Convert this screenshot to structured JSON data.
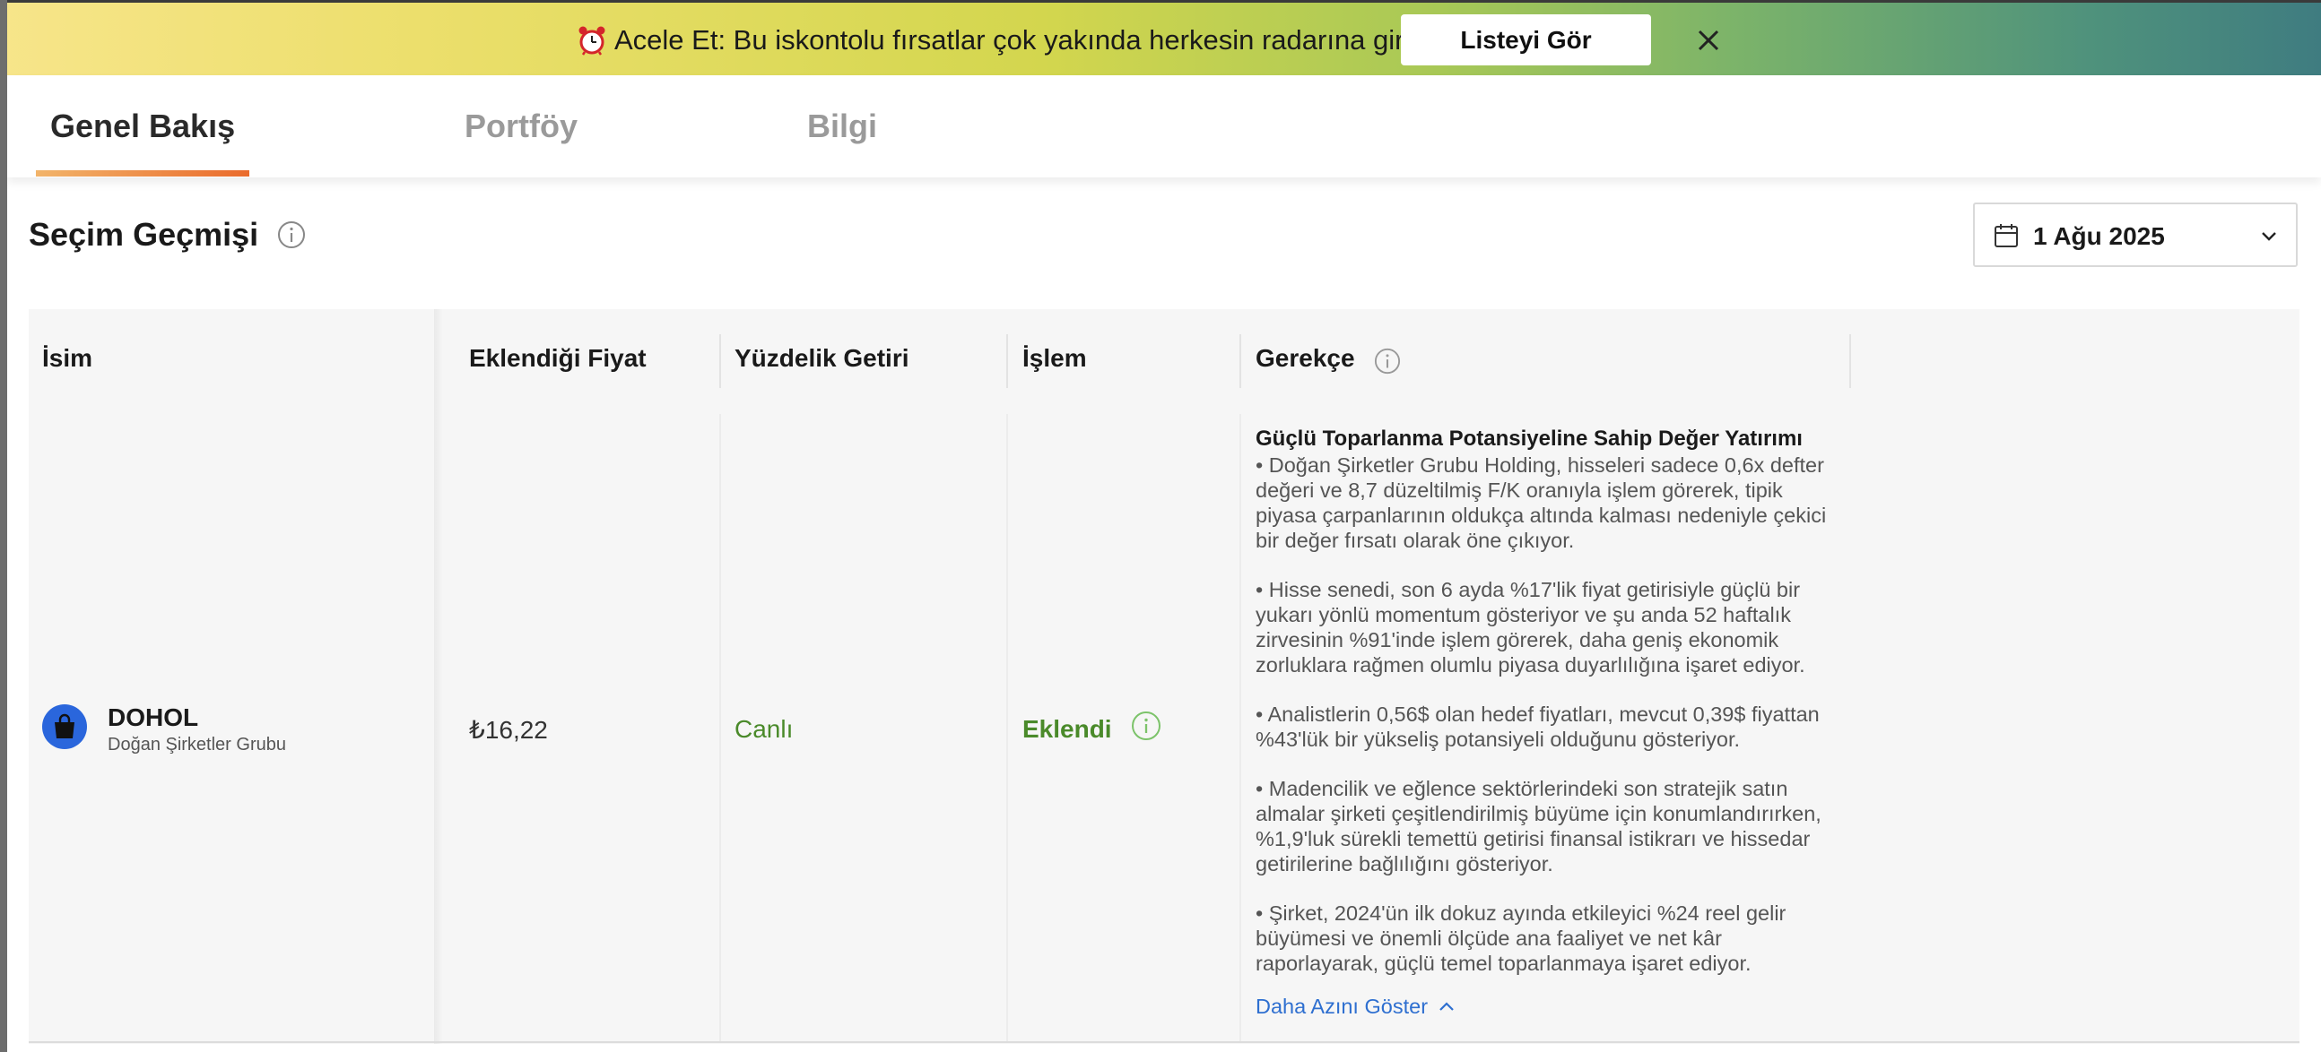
{
  "banner": {
    "text": "Acele Et: Bu iskontolu fırsatlar çok yakında herkesin radarına girecek",
    "button_label": "Listeyi Gör",
    "icon": "alarm-clock-icon",
    "close_icon": "close-icon"
  },
  "tabs": [
    {
      "label": "Genel Bakış",
      "active": true
    },
    {
      "label": "Portföy",
      "active": false
    },
    {
      "label": "Bilgi",
      "active": false
    }
  ],
  "section": {
    "title": "Seçim Geçmişi",
    "date": "1 Ağu 2025"
  },
  "table": {
    "headers": {
      "name": "İsim",
      "price": "Eklendiği Fiyat",
      "return": "Yüzdelik Getiri",
      "action": "İşlem",
      "rationale": "Gerekçe"
    },
    "rows": [
      {
        "ticker": "DOHOL",
        "company": "Doğan Şirketler Grubu",
        "price": "₺16,22",
        "return": "Canlı",
        "action": "Eklendi",
        "rationale_title": "Güçlü Toparlanma Potansiyeline Sahip Değer Yatırımı",
        "rationale_points": [
          "• Doğan Şirketler Grubu Holding, hisseleri sadece 0,6x defter değeri ve 8,7 düzeltilmiş F/K oranıyla işlem görerek, tipik piyasa çarpanlarının oldukça altında kalması nedeniyle çekici bir değer fırsatı olarak öne çıkıyor.",
          "• Hisse senedi, son 6 ayda %17'lik fiyat getirisiyle güçlü bir yukarı yönlü momentum gösteriyor ve şu anda 52 haftalık zirvesinin %91'inde işlem görerek, daha geniş ekonomik zorluklara rağmen olumlu piyasa duyarlılığına işaret ediyor.",
          "• Analistlerin 0,56$ olan hedef fiyatları, mevcut 0,39$ fiyattan %43'lük bir yükseliş potansiyeli olduğunu gösteriyor.",
          "• Madencilik ve eğlence sektörlerindeki son stratejik satın almalar şirketi çeşitlendirilmiş büyüme için konumlandırırken, %1,9'luk sürekli temettü getirisi finansal istikrarı ve hissedar getirilerine bağlılığını gösteriyor.",
          "• Şirket, 2024'ün ilk dokuz ayında etkileyici %24 reel gelir büyümesi ve önemli ölçüde ana faaliyet ve net kâr raporlayarak, güçlü temel toparlanmaya işaret ediyor."
        ],
        "show_less": "Daha Azını Göster"
      }
    ]
  },
  "colors": {
    "accent_orange": "#ea6b2c",
    "positive_green": "#4a8a2a",
    "link_blue": "#2e6fd0",
    "avatar_blue": "#2a66dc"
  }
}
